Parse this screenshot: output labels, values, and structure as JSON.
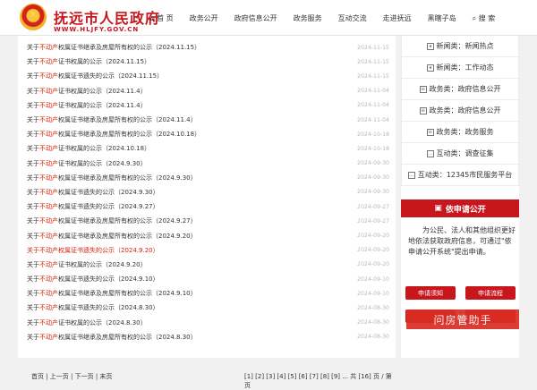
{
  "header": {
    "title": "抚远市人民政府",
    "url": "WWW.HLJFY.GOV.CN",
    "nav": [
      {
        "label": "首 页"
      },
      {
        "label": "政务公开"
      },
      {
        "label": "政府信息公开"
      },
      {
        "label": "政务服务"
      },
      {
        "label": "互动交流"
      },
      {
        "label": "走进抚远"
      },
      {
        "label": "黑瞎子岛"
      },
      {
        "label": "搜 索"
      }
    ]
  },
  "list": [
    {
      "pre": "关于",
      "red": "不动产",
      "post": "权属证书继承及房屋所有权的公示（2024.11.15）",
      "date": "2024-11-15",
      "highlight": false
    },
    {
      "pre": "关于",
      "red": "不动产",
      "post": "证书权属的公示（2024.11.15）",
      "date": "2024-11-15",
      "highlight": false
    },
    {
      "pre": "关于",
      "red": "不动产",
      "post": "权属证书遗失的公示（2024.11.15）",
      "date": "2024-11-15",
      "highlight": false
    },
    {
      "pre": "关于",
      "red": "不动产",
      "post": "证书权属的公示（2024.11.4）",
      "date": "2024-11-04",
      "highlight": false
    },
    {
      "pre": "关于",
      "red": "不动产",
      "post": "证书权属的公示（2024.11.4）",
      "date": "2024-11-04",
      "highlight": false
    },
    {
      "pre": "关于",
      "red": "不动产",
      "post": "权属证书继承及房屋所有权的公示（2024.11.4）",
      "date": "2024-11-04",
      "highlight": false
    },
    {
      "pre": "关于",
      "red": "不动产",
      "post": "权属证书继承及房屋所有权的公示（2024.10.18）",
      "date": "2024-10-18",
      "highlight": false
    },
    {
      "pre": "关于",
      "red": "不动产",
      "post": "证书权属的公示（2024.10.18）",
      "date": "2024-10-18",
      "highlight": false
    },
    {
      "pre": "关于",
      "red": "不动产",
      "post": "证书权属的公示（2024.9.30）",
      "date": "2024-09-30",
      "highlight": false
    },
    {
      "pre": "关于",
      "red": "不动产",
      "post": "权属证书继承及房屋所有权的公示（2024.9.30）",
      "date": "2024-09-30",
      "highlight": false
    },
    {
      "pre": "关于",
      "red": "不动产",
      "post": "权属证书遗失的公示（2024.9.30）",
      "date": "2024-09-30",
      "highlight": false
    },
    {
      "pre": "关于",
      "red": "不动产",
      "post": "权属证书遗失的公示（2024.9.27）",
      "date": "2024-09-27",
      "highlight": false
    },
    {
      "pre": "关于",
      "red": "不动产",
      "post": "权属证书继承及房屋所有权的公示（2024.9.27）",
      "date": "2024-09-27",
      "highlight": false
    },
    {
      "pre": "关于",
      "red": "不动产",
      "post": "权属证书继承及房屋所有权的公示（2024.9.20）",
      "date": "2024-09-20",
      "highlight": false
    },
    {
      "pre": "关于",
      "red": "不动产",
      "post": "权属证书遗失的公示（2024.9.20）",
      "date": "2024-09-20",
      "highlight": true
    },
    {
      "pre": "关于",
      "red": "不动产",
      "post": "证书权属的公示（2024.9.20）",
      "date": "2024-09-20",
      "highlight": false
    },
    {
      "pre": "关于",
      "red": "不动产",
      "post": "权属证书遗失的公示（2024.9.10）",
      "date": "2024-09-10",
      "highlight": false
    },
    {
      "pre": "关于",
      "red": "不动产",
      "post": "权属证书继承及房屋所有权的公示（2024.9.10）",
      "date": "2024-09-10",
      "highlight": false
    },
    {
      "pre": "关于",
      "red": "不动产",
      "post": "权属证书遗失的公示（2024.8.30）",
      "date": "2024-08-30",
      "highlight": false
    },
    {
      "pre": "关于",
      "red": "不动产",
      "post": "证书权属的公示（2024.8.30）",
      "date": "2024-08-30",
      "highlight": false
    },
    {
      "pre": "关于",
      "red": "不动产",
      "post": "权属证书继承及房屋所有权的公示（2024.8.30）",
      "date": "2024-08-30",
      "highlight": false
    }
  ],
  "pager": {
    "left": "首页 | 上一页 | 下一页 | 末页",
    "right": "[1] [2] [3] [4] [5] [6] [7] [8] [9] ... 共 [16] 页 / 第 页"
  },
  "sidebar": {
    "items": [
      {
        "label": "新闻类：新闻热点"
      },
      {
        "label": "新闻类：工作动态"
      },
      {
        "label": "政务类：政府信息公开"
      },
      {
        "label": "政务类：政府信息公开"
      },
      {
        "label": "政务类：政务服务"
      },
      {
        "label": "互动类：调查征集"
      },
      {
        "label": "互动类：12345市民服务平台"
      }
    ],
    "apply_title": "依申请公开",
    "apply_text": "为公民、法人和其他组织更好地依法获取政府信息，可通过\"依申请公开系统\"提出申请。",
    "buttons": [
      {
        "label": "申请须知"
      },
      {
        "label": "申请流程"
      },
      {
        "label": ""
      },
      {
        "label": ""
      }
    ]
  },
  "watermark": "问房管助手"
}
